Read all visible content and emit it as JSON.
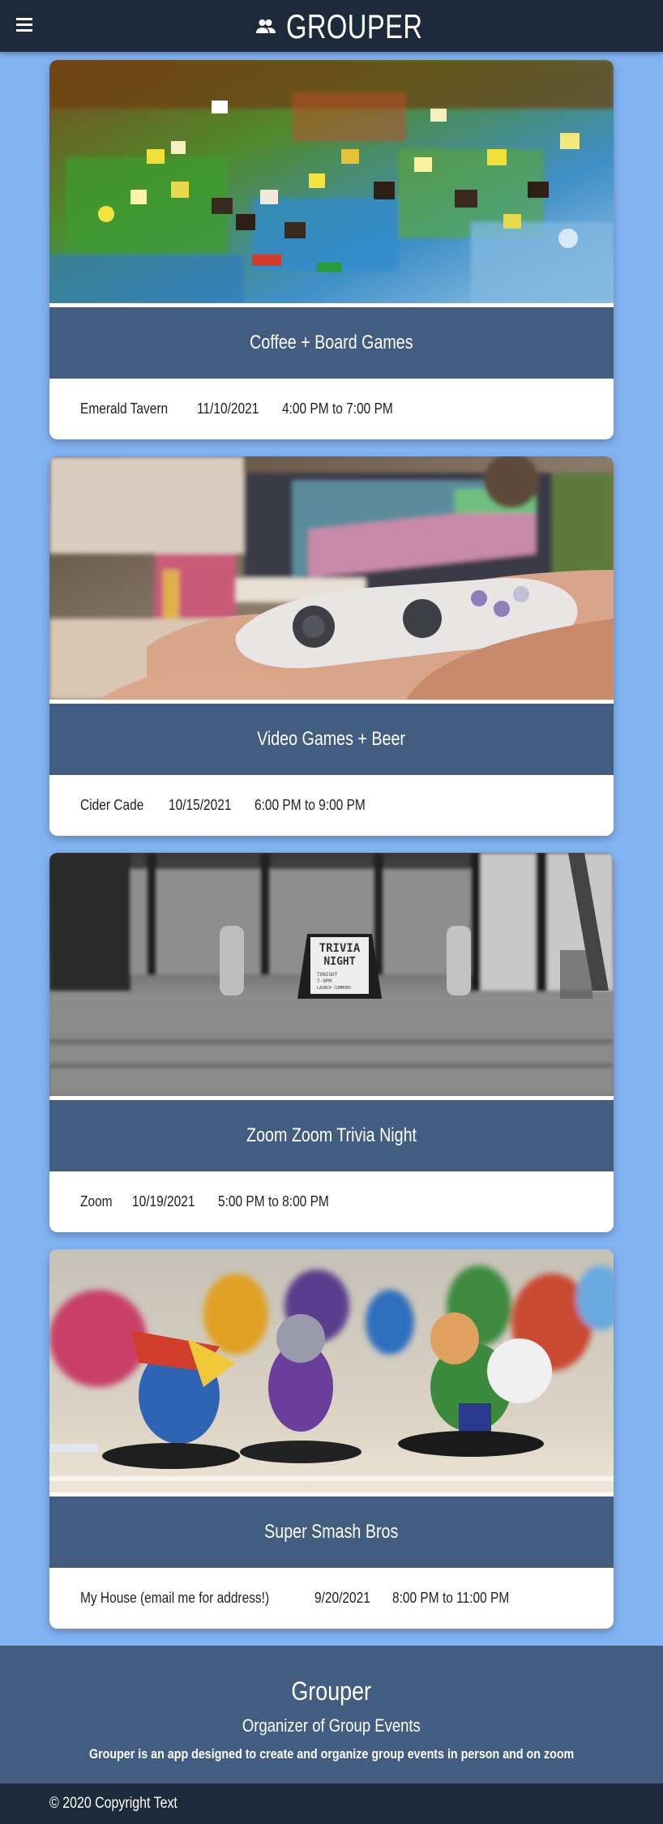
{
  "nav": {
    "brand": "GROUPER",
    "menu_icon": "hamburger-menu-icon",
    "brand_icon": "people-group-icon"
  },
  "events": [
    {
      "title": "Coffee + Board Games",
      "location": "Emerald Tavern",
      "date": "11/10/2021",
      "time": "4:00 PM to 7:00 PM",
      "image_subject": "board game pieces on a colorful game board"
    },
    {
      "title": "Video Games + Beer",
      "location": "Cider Cade",
      "date": "10/15/2021",
      "time": "6:00 PM to 9:00 PM",
      "image_subject": "hands holding a game controller in front of a TV"
    },
    {
      "title": "Zoom Zoom Trivia Night",
      "location": "Zoom",
      "date": "10/19/2021",
      "time": "5:00 PM to 8:00 PM",
      "image_subject": "black and white photo of a trivia night sign",
      "sign_text": [
        "TRIVIA",
        "NIGHT",
        "TONIGHT",
        "7-9PM",
        "LAUNCH COMMONS"
      ]
    },
    {
      "title": "Super Smash Bros",
      "location": "My House (email me for address!)",
      "date": "9/20/2021",
      "time": "8:00 PM to 11:00 PM",
      "image_subject": "amiibo figurines of smash bros characters"
    }
  ],
  "footer": {
    "title": "Grouper",
    "subtitle": "Organizer of Group Events",
    "description": "Grouper is an app designed to create and organize group events in person and on zoom",
    "copyright": "© 2020 Copyright Text"
  },
  "colors": {
    "page_background": "#82b3f3",
    "navbar": "#1c2a3b",
    "card_title_bar": "#425d7f",
    "footer": "#425d7f",
    "copyright_bar": "#1c2a3b"
  }
}
